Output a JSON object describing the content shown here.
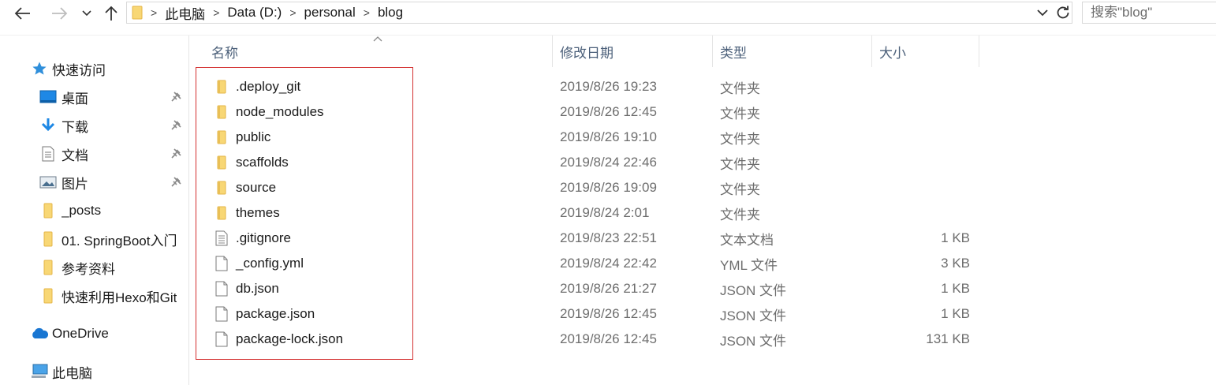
{
  "address_bar": {
    "path": [
      "此电脑",
      "Data (D:)",
      "personal",
      "blog"
    ],
    "separator": ">"
  },
  "search": {
    "placeholder": "搜索\"blog\""
  },
  "nav_pane": {
    "quick_access": {
      "label": "快速访问"
    },
    "pinned": [
      {
        "label": "桌面",
        "icon": "desktop-icon"
      },
      {
        "label": "下载",
        "icon": "download-icon"
      },
      {
        "label": "文档",
        "icon": "document-icon"
      },
      {
        "label": "图片",
        "icon": "pictures-icon"
      }
    ],
    "folders": [
      {
        "label": "_posts"
      },
      {
        "label": "01. SpringBoot入门"
      },
      {
        "label": "参考资料"
      },
      {
        "label": "快速利用Hexo和Git"
      }
    ],
    "onedrive": {
      "label": "OneDrive"
    },
    "this_pc": {
      "label": "此电脑"
    }
  },
  "columns": {
    "name": "名称",
    "date": "修改日期",
    "type": "类型",
    "size": "大小"
  },
  "files": [
    {
      "name": ".deploy_git",
      "date": "2019/8/26 19:23",
      "type": "文件夹",
      "size": "",
      "icon": "folder-icon"
    },
    {
      "name": "node_modules",
      "date": "2019/8/26 12:45",
      "type": "文件夹",
      "size": "",
      "icon": "folder-icon"
    },
    {
      "name": "public",
      "date": "2019/8/26 19:10",
      "type": "文件夹",
      "size": "",
      "icon": "folder-icon"
    },
    {
      "name": "scaffolds",
      "date": "2019/8/24 22:46",
      "type": "文件夹",
      "size": "",
      "icon": "folder-icon"
    },
    {
      "name": "source",
      "date": "2019/8/26 19:09",
      "type": "文件夹",
      "size": "",
      "icon": "folder-icon"
    },
    {
      "name": "themes",
      "date": "2019/8/24 2:01",
      "type": "文件夹",
      "size": "",
      "icon": "folder-icon"
    },
    {
      "name": ".gitignore",
      "date": "2019/8/23 22:51",
      "type": "文本文档",
      "size": "1 KB",
      "icon": "text-file-icon"
    },
    {
      "name": "_config.yml",
      "date": "2019/8/24 22:42",
      "type": "YML 文件",
      "size": "3 KB",
      "icon": "file-icon"
    },
    {
      "name": "db.json",
      "date": "2019/8/26 21:27",
      "type": "JSON 文件",
      "size": "1 KB",
      "icon": "file-icon"
    },
    {
      "name": "package.json",
      "date": "2019/8/26 12:45",
      "type": "JSON 文件",
      "size": "1 KB",
      "icon": "file-icon"
    },
    {
      "name": "package-lock.json",
      "date": "2019/8/26 12:45",
      "type": "JSON 文件",
      "size": "131 KB",
      "icon": "file-icon"
    }
  ],
  "colors": {
    "folder": "#f8d775",
    "folder_dark": "#e4b647",
    "header_text": "#4c607a",
    "highlight_box": "#d32f2f",
    "accent": "#1e90ff"
  }
}
